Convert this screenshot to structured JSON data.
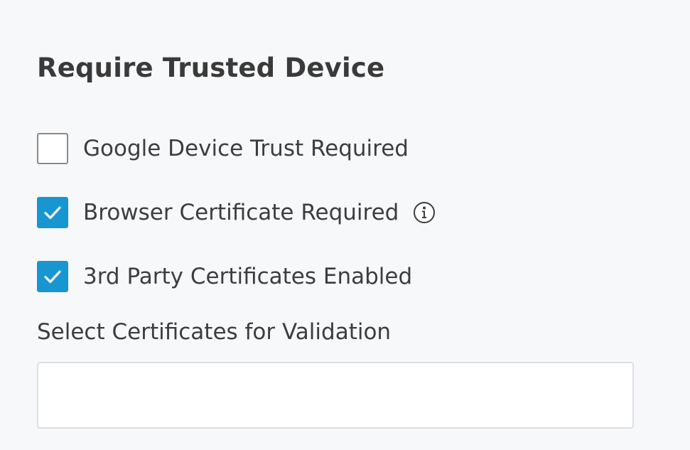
{
  "section": {
    "title": "Require Trusted Device"
  },
  "options": [
    {
      "label": "Google Device Trust Required",
      "checked": false
    },
    {
      "label": "Browser Certificate Required",
      "checked": true,
      "info_icon": "info-icon"
    },
    {
      "label": "3rd Party Certificates Enabled",
      "checked": true
    }
  ],
  "certificates": {
    "label": "Select Certificates for Validation",
    "value": "",
    "placeholder": ""
  },
  "colors": {
    "accent": "#1796d2",
    "background": "#f7f8fa",
    "text": "#3d3d3d"
  }
}
